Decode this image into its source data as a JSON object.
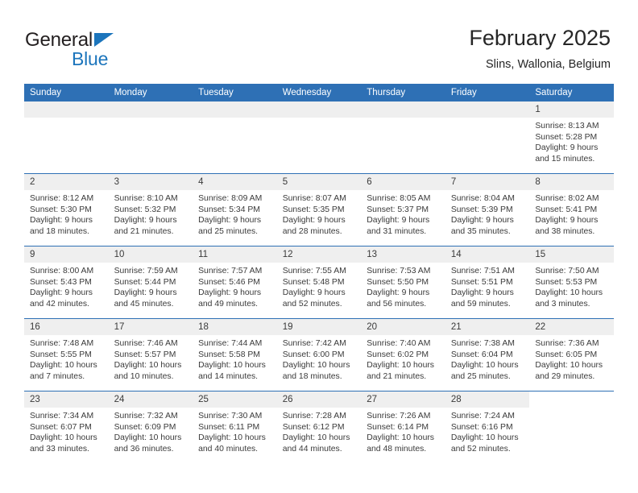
{
  "brand": {
    "name_part1": "General",
    "name_part2": "Blue",
    "triangle_icon": "triangle-icon",
    "accent_color": "#1c75bc"
  },
  "header": {
    "title": "February 2025",
    "subtitle": "Slins, Wallonia, Belgium",
    "header_bg_color": "#2e70b5",
    "daynum_bg_color": "#efefef"
  },
  "weekday_headers": [
    "Sunday",
    "Monday",
    "Tuesday",
    "Wednesday",
    "Thursday",
    "Friday",
    "Saturday"
  ],
  "labels": {
    "sunrise": "Sunrise:",
    "sunset": "Sunset:",
    "daylight": "Daylight:"
  },
  "weeks": [
    [
      {
        "day": "",
        "sunrise": "",
        "sunset": "",
        "daylight_line1": "",
        "daylight_line2": "",
        "empty": true
      },
      {
        "day": "",
        "sunrise": "",
        "sunset": "",
        "daylight_line1": "",
        "daylight_line2": "",
        "empty": true
      },
      {
        "day": "",
        "sunrise": "",
        "sunset": "",
        "daylight_line1": "",
        "daylight_line2": "",
        "empty": true
      },
      {
        "day": "",
        "sunrise": "",
        "sunset": "",
        "daylight_line1": "",
        "daylight_line2": "",
        "empty": true
      },
      {
        "day": "",
        "sunrise": "",
        "sunset": "",
        "daylight_line1": "",
        "daylight_line2": "",
        "empty": true
      },
      {
        "day": "",
        "sunrise": "",
        "sunset": "",
        "daylight_line1": "",
        "daylight_line2": "",
        "empty": true
      },
      {
        "day": "1",
        "sunrise": "Sunrise: 8:13 AM",
        "sunset": "Sunset: 5:28 PM",
        "daylight_line1": "Daylight: 9 hours",
        "daylight_line2": "and 15 minutes."
      }
    ],
    [
      {
        "day": "2",
        "sunrise": "Sunrise: 8:12 AM",
        "sunset": "Sunset: 5:30 PM",
        "daylight_line1": "Daylight: 9 hours",
        "daylight_line2": "and 18 minutes."
      },
      {
        "day": "3",
        "sunrise": "Sunrise: 8:10 AM",
        "sunset": "Sunset: 5:32 PM",
        "daylight_line1": "Daylight: 9 hours",
        "daylight_line2": "and 21 minutes."
      },
      {
        "day": "4",
        "sunrise": "Sunrise: 8:09 AM",
        "sunset": "Sunset: 5:34 PM",
        "daylight_line1": "Daylight: 9 hours",
        "daylight_line2": "and 25 minutes."
      },
      {
        "day": "5",
        "sunrise": "Sunrise: 8:07 AM",
        "sunset": "Sunset: 5:35 PM",
        "daylight_line1": "Daylight: 9 hours",
        "daylight_line2": "and 28 minutes."
      },
      {
        "day": "6",
        "sunrise": "Sunrise: 8:05 AM",
        "sunset": "Sunset: 5:37 PM",
        "daylight_line1": "Daylight: 9 hours",
        "daylight_line2": "and 31 minutes."
      },
      {
        "day": "7",
        "sunrise": "Sunrise: 8:04 AM",
        "sunset": "Sunset: 5:39 PM",
        "daylight_line1": "Daylight: 9 hours",
        "daylight_line2": "and 35 minutes."
      },
      {
        "day": "8",
        "sunrise": "Sunrise: 8:02 AM",
        "sunset": "Sunset: 5:41 PM",
        "daylight_line1": "Daylight: 9 hours",
        "daylight_line2": "and 38 minutes."
      }
    ],
    [
      {
        "day": "9",
        "sunrise": "Sunrise: 8:00 AM",
        "sunset": "Sunset: 5:43 PM",
        "daylight_line1": "Daylight: 9 hours",
        "daylight_line2": "and 42 minutes."
      },
      {
        "day": "10",
        "sunrise": "Sunrise: 7:59 AM",
        "sunset": "Sunset: 5:44 PM",
        "daylight_line1": "Daylight: 9 hours",
        "daylight_line2": "and 45 minutes."
      },
      {
        "day": "11",
        "sunrise": "Sunrise: 7:57 AM",
        "sunset": "Sunset: 5:46 PM",
        "daylight_line1": "Daylight: 9 hours",
        "daylight_line2": "and 49 minutes."
      },
      {
        "day": "12",
        "sunrise": "Sunrise: 7:55 AM",
        "sunset": "Sunset: 5:48 PM",
        "daylight_line1": "Daylight: 9 hours",
        "daylight_line2": "and 52 minutes."
      },
      {
        "day": "13",
        "sunrise": "Sunrise: 7:53 AM",
        "sunset": "Sunset: 5:50 PM",
        "daylight_line1": "Daylight: 9 hours",
        "daylight_line2": "and 56 minutes."
      },
      {
        "day": "14",
        "sunrise": "Sunrise: 7:51 AM",
        "sunset": "Sunset: 5:51 PM",
        "daylight_line1": "Daylight: 9 hours",
        "daylight_line2": "and 59 minutes."
      },
      {
        "day": "15",
        "sunrise": "Sunrise: 7:50 AM",
        "sunset": "Sunset: 5:53 PM",
        "daylight_line1": "Daylight: 10 hours",
        "daylight_line2": "and 3 minutes."
      }
    ],
    [
      {
        "day": "16",
        "sunrise": "Sunrise: 7:48 AM",
        "sunset": "Sunset: 5:55 PM",
        "daylight_line1": "Daylight: 10 hours",
        "daylight_line2": "and 7 minutes."
      },
      {
        "day": "17",
        "sunrise": "Sunrise: 7:46 AM",
        "sunset": "Sunset: 5:57 PM",
        "daylight_line1": "Daylight: 10 hours",
        "daylight_line2": "and 10 minutes."
      },
      {
        "day": "18",
        "sunrise": "Sunrise: 7:44 AM",
        "sunset": "Sunset: 5:58 PM",
        "daylight_line1": "Daylight: 10 hours",
        "daylight_line2": "and 14 minutes."
      },
      {
        "day": "19",
        "sunrise": "Sunrise: 7:42 AM",
        "sunset": "Sunset: 6:00 PM",
        "daylight_line1": "Daylight: 10 hours",
        "daylight_line2": "and 18 minutes."
      },
      {
        "day": "20",
        "sunrise": "Sunrise: 7:40 AM",
        "sunset": "Sunset: 6:02 PM",
        "daylight_line1": "Daylight: 10 hours",
        "daylight_line2": "and 21 minutes."
      },
      {
        "day": "21",
        "sunrise": "Sunrise: 7:38 AM",
        "sunset": "Sunset: 6:04 PM",
        "daylight_line1": "Daylight: 10 hours",
        "daylight_line2": "and 25 minutes."
      },
      {
        "day": "22",
        "sunrise": "Sunrise: 7:36 AM",
        "sunset": "Sunset: 6:05 PM",
        "daylight_line1": "Daylight: 10 hours",
        "daylight_line2": "and 29 minutes."
      }
    ],
    [
      {
        "day": "23",
        "sunrise": "Sunrise: 7:34 AM",
        "sunset": "Sunset: 6:07 PM",
        "daylight_line1": "Daylight: 10 hours",
        "daylight_line2": "and 33 minutes."
      },
      {
        "day": "24",
        "sunrise": "Sunrise: 7:32 AM",
        "sunset": "Sunset: 6:09 PM",
        "daylight_line1": "Daylight: 10 hours",
        "daylight_line2": "and 36 minutes."
      },
      {
        "day": "25",
        "sunrise": "Sunrise: 7:30 AM",
        "sunset": "Sunset: 6:11 PM",
        "daylight_line1": "Daylight: 10 hours",
        "daylight_line2": "and 40 minutes."
      },
      {
        "day": "26",
        "sunrise": "Sunrise: 7:28 AM",
        "sunset": "Sunset: 6:12 PM",
        "daylight_line1": "Daylight: 10 hours",
        "daylight_line2": "and 44 minutes."
      },
      {
        "day": "27",
        "sunrise": "Sunrise: 7:26 AM",
        "sunset": "Sunset: 6:14 PM",
        "daylight_line1": "Daylight: 10 hours",
        "daylight_line2": "and 48 minutes."
      },
      {
        "day": "28",
        "sunrise": "Sunrise: 7:24 AM",
        "sunset": "Sunset: 6:16 PM",
        "daylight_line1": "Daylight: 10 hours",
        "daylight_line2": "and 52 minutes."
      },
      {
        "day": "",
        "sunrise": "",
        "sunset": "",
        "daylight_line1": "",
        "daylight_line2": "",
        "empty": true,
        "nodata": true
      }
    ]
  ]
}
